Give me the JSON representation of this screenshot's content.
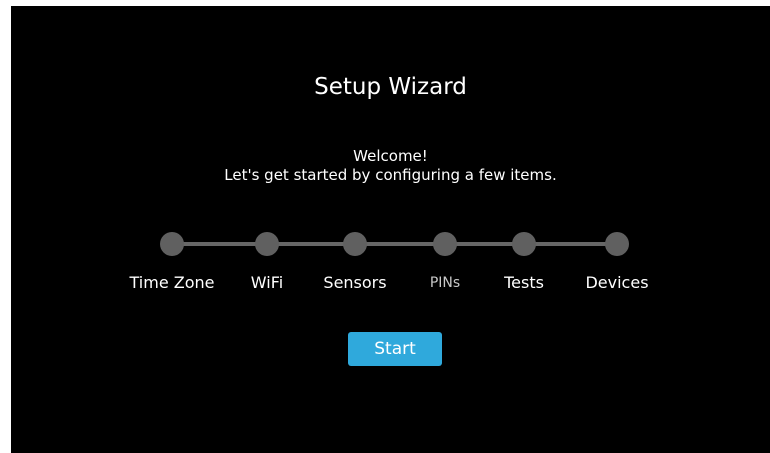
{
  "wizard": {
    "title": "Setup Wizard",
    "welcome_line1": "Welcome!",
    "welcome_line2": "Let's get started by configuring a few items."
  },
  "steps": [
    {
      "label": "Time Zone"
    },
    {
      "label": "WiFi"
    },
    {
      "label": "Sensors"
    },
    {
      "label": "PINs"
    },
    {
      "label": "Tests"
    },
    {
      "label": "Devices"
    }
  ],
  "actions": {
    "start_label": "Start"
  },
  "colors": {
    "background": "#000000",
    "accent": "#2fa9dc",
    "step_inactive": "#606060",
    "connector": "#666666"
  }
}
